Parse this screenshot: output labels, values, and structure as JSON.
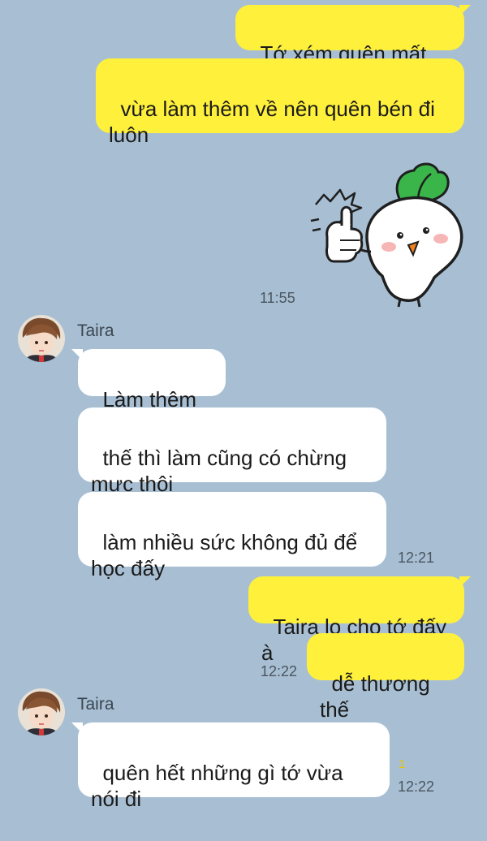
{
  "messages": {
    "m1": {
      "text": "Tớ xém quên mất đấy"
    },
    "m2": {
      "text": "vừa làm thêm về nên quên bén đi luôn"
    },
    "sticker_time": "11:55",
    "taira1": {
      "sender": "Taira",
      "m3": "Làm thêm à?",
      "m4": "thế thì làm cũng có chừng mực thôi",
      "m5": "làm nhiều sức không đủ để học đấy",
      "time": "12:21"
    },
    "m6": {
      "text": "Taira lo cho tớ đấy à"
    },
    "m7": {
      "text": "dễ thương thế"
    },
    "sent_time": "12:22",
    "taira2": {
      "sender": "Taira",
      "m8": "quên hết những gì tớ vừa nói đi",
      "unread": "1",
      "time": "12:22"
    }
  },
  "colors": {
    "background": "#a8bfd3",
    "sent_bubble": "#fef03b",
    "received_bubble": "#ffffff"
  },
  "icons": {
    "sticker": "radish-thumbs-up-sticker",
    "avatar": "taira-avatar"
  }
}
